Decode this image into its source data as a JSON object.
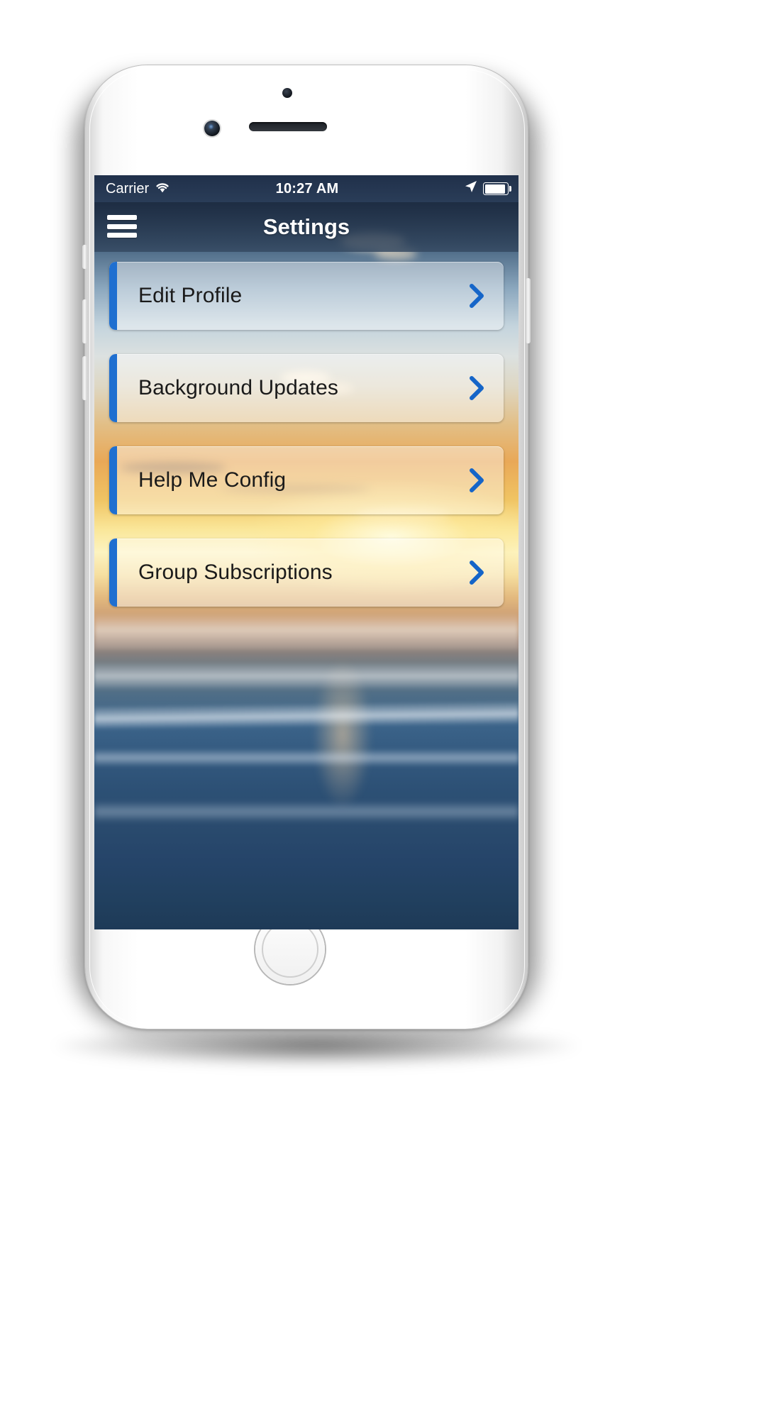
{
  "status_bar": {
    "carrier": "Carrier",
    "wifi_icon": "wifi-icon",
    "time": "10:27 AM",
    "location_icon": "location-arrow-icon",
    "battery_icon": "battery-full-icon",
    "background_color": "#20304a",
    "text_color": "#ffffff"
  },
  "nav_bar": {
    "menu_icon": "hamburger-menu-icon",
    "title": "Settings"
  },
  "menu": {
    "accent_color": "#1f6fd0",
    "chevron_color": "#1565c8",
    "items": [
      {
        "label": "Edit Profile",
        "chevron": "chevron-right-icon"
      },
      {
        "label": "Background Updates",
        "chevron": "chevron-right-icon"
      },
      {
        "label": "Help Me Config",
        "chevron": "chevron-right-icon"
      },
      {
        "label": "Group Subscriptions",
        "chevron": "chevron-right-icon"
      }
    ]
  },
  "device": {
    "type": "white-smartphone",
    "camera_icon": "rear-camera-icon",
    "speaker_icon": "earpiece-speaker-icon",
    "home_button_icon": "home-button-icon"
  }
}
